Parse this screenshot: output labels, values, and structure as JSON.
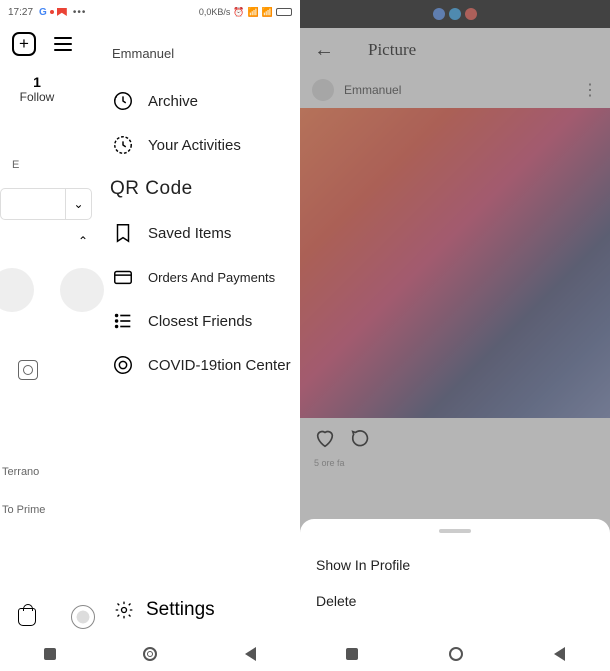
{
  "left": {
    "status": {
      "time": "17:27",
      "net": "0,0KB/s"
    },
    "username": "Emmanuel",
    "stat_num": "1",
    "stat_label": "Follow",
    "truncated": "E",
    "tabs_caret": "⌄",
    "footer_line1": "Terrano",
    "footer_line2": "To Prime",
    "menu": {
      "archive": "Archive",
      "activities": "Your Activities",
      "qr": "QR Code",
      "saved": "Saved Items",
      "orders": "Orders And Payments",
      "friends": "Closest Friends",
      "covid_main": "COVID-19",
      "covid_tail": "tion Center",
      "settings": "Settings"
    }
  },
  "right": {
    "header_title": "Picture",
    "poster": "Emmanuel",
    "timeago": "5 ore fa",
    "sheet": {
      "opt1": "Show In Profile",
      "opt2": "Delete"
    }
  }
}
